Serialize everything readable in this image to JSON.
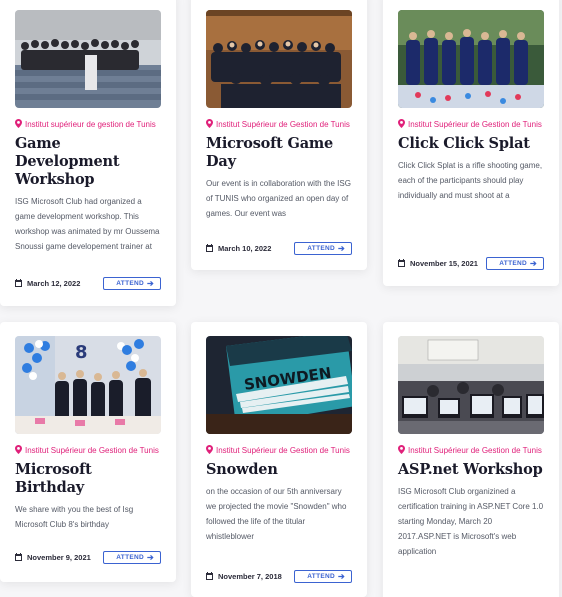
{
  "cards": [
    {
      "location": "Institut supérieur de gestion de Tunis",
      "title": "Game Development Workshop",
      "description": "ISG Microsoft Club had organized a game development workshop. This workshop was animated by mr Oussema Snoussi game developement trainer at",
      "date": "March 12, 2022",
      "attend_label": "ATTEND",
      "photo_icon": "group-photo-icon"
    },
    {
      "location": "Institut Supérieur de Gestion de Tunis",
      "title": "Microsoft Game Day",
      "description": "Our event is in collaboration with the ISG of TUNIS who organized an open day of games. Our event was",
      "date": "March 10, 2022",
      "attend_label": "ATTEND",
      "photo_icon": "group-photo-icon"
    },
    {
      "location": "Institut Supérieur de Gestion de Tunis",
      "title": "Click Click Splat",
      "description": "Click Click Splat is a rifle shooting game, each of the participants should play individually and must shoot at a",
      "date": "November 15, 2021",
      "attend_label": "ATTEND",
      "photo_icon": "group-photo-icon"
    },
    {
      "location": "Institut Supérieur de Gestion de Tunis",
      "title": "Microsoft Birthday",
      "description": "We share with you the best of Isg Microsoft Club 8's birthday",
      "date": "November 9, 2021",
      "attend_label": "ATTEND",
      "photo_icon": "party-photo-icon"
    },
    {
      "location": "Institut Supérieur de Gestion de Tunis",
      "title": "Snowden",
      "description": "on the occasion of our 5th anniversary we projected the movie \"Snowden\" who followed the life of the titular whistleblower",
      "date": "November 7, 2018",
      "attend_label": "ATTEND",
      "photo_icon": "movie-poster-icon",
      "poster_text": "SNOWDEN"
    },
    {
      "location": "Institut Supérieur de Gestion de Tunis",
      "title": "ASP.net Workshop",
      "description": "ISG Microsoft Club organizined a certification training in ASP.NET Core 1.0 starting Monday, March 20 2017.ASP.NET is Microsoft's web application",
      "date": "",
      "attend_label": "",
      "photo_icon": "classroom-photo-icon"
    }
  ],
  "colors": {
    "location": "#e0207a",
    "attend": "#3b63d1",
    "title": "#1a1a2a"
  }
}
